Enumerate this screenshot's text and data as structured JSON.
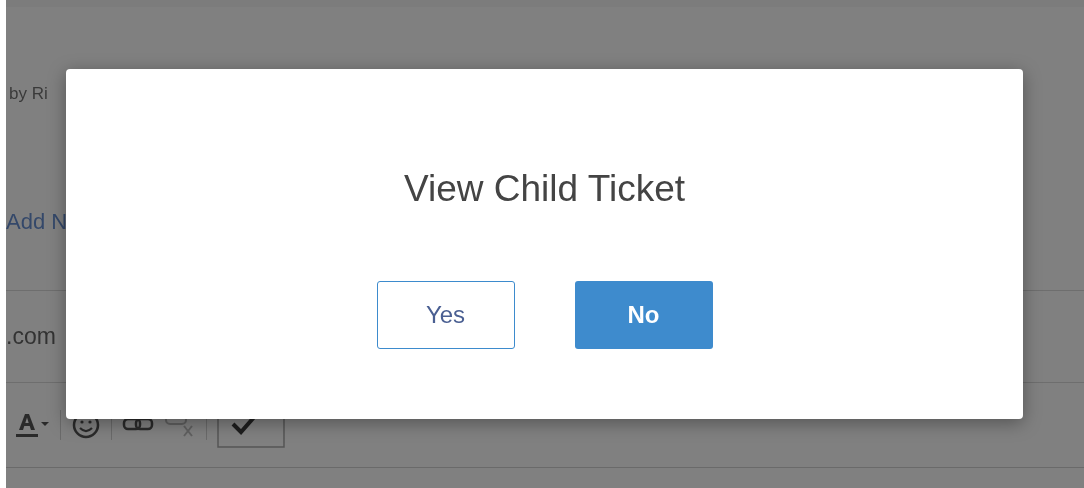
{
  "background": {
    "byline": "by Ri",
    "add_link": "Add N",
    "email_fragment": ".com"
  },
  "dialog": {
    "title": "View Child Ticket",
    "buttons": [
      {
        "label": "Yes",
        "kind": "outline"
      },
      {
        "label": "No",
        "kind": "primary"
      }
    ]
  }
}
